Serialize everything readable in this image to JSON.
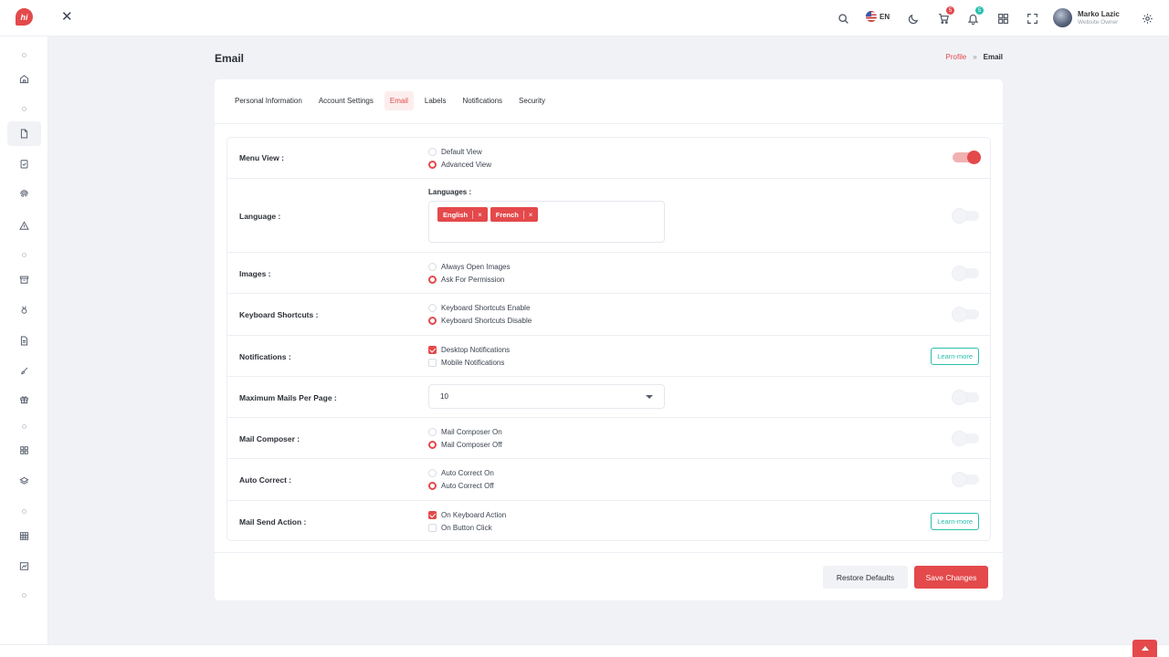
{
  "header": {
    "lang_code": "EN",
    "cart_badge": "5",
    "notif_badge": "5",
    "user_name": "Marko Lazic",
    "user_role": "Website Owner",
    "colors": {
      "accent": "#e4494b",
      "teal": "#2bbfad"
    }
  },
  "page": {
    "title": "Email",
    "breadcrumb": {
      "parent": "Profile",
      "separator": "»",
      "current": "Email"
    }
  },
  "tabs": [
    {
      "label": "Personal Information"
    },
    {
      "label": "Account Settings"
    },
    {
      "label": "Email",
      "active": true
    },
    {
      "label": "Labels"
    },
    {
      "label": "Notifications"
    },
    {
      "label": "Security"
    }
  ],
  "settings": {
    "menu_view": {
      "label": "Menu View :",
      "options": [
        "Default View",
        "Advanced View"
      ],
      "selected": "Advanced View",
      "toggle_on": true
    },
    "language": {
      "label": "Language :",
      "field_label": "Languages :",
      "tags": [
        "English",
        "French"
      ],
      "tag_remove": "×",
      "toggle_on": false
    },
    "images": {
      "label": "Images :",
      "options": [
        "Always Open Images",
        "Ask For Permission"
      ],
      "selected": "Ask For Permission",
      "toggle_on": false
    },
    "keyboard": {
      "label": "Keyboard Shortcuts :",
      "options": [
        "Keyboard Shortcuts Enable",
        "Keyboard Shortcuts Disable"
      ],
      "selected": "Keyboard Shortcuts Disable",
      "toggle_on": false
    },
    "notifications": {
      "label": "Notifications :",
      "options": [
        "Desktop Notifications",
        "Mobile Notifications"
      ],
      "checked": [
        "Desktop Notifications"
      ],
      "button": "Learn-more"
    },
    "max_mails": {
      "label": "Maximum Mails Per Page :",
      "value": "10",
      "toggle_on": false
    },
    "composer": {
      "label": "Mail Composer :",
      "options": [
        "Mail Composer On",
        "Mail Composer Off"
      ],
      "selected": "Mail Composer Off",
      "toggle_on": false
    },
    "auto_correct": {
      "label": "Auto Correct :",
      "options": [
        "Auto Correct On",
        "Auto Correct Off"
      ],
      "selected": "Auto Correct Off",
      "toggle_on": false
    },
    "send_action": {
      "label": "Mail Send Action :",
      "options": [
        "On Keyboard Action",
        "On Button Click"
      ],
      "checked": [
        "On Keyboard Action"
      ],
      "button": "Learn-more"
    }
  },
  "actions": {
    "restore": "Restore Defaults",
    "save": "Save Changes"
  }
}
